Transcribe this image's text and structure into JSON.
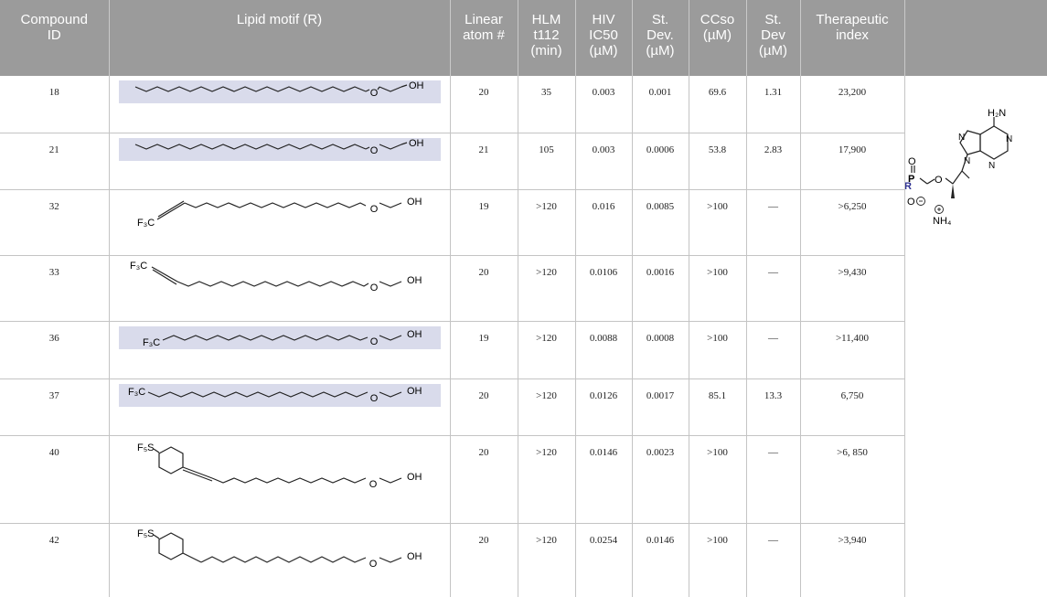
{
  "table": {
    "headers": {
      "compound": [
        "Compound",
        "ID"
      ],
      "motif": [
        "Lipid motif (R)"
      ],
      "linear": [
        "Linear",
        "atom #"
      ],
      "hlm": [
        "HLM",
        "t112",
        "(min)"
      ],
      "hiv": [
        "HIV",
        "IC50",
        "(µM)"
      ],
      "sd1": [
        "St.",
        "Dev.",
        "(µM)"
      ],
      "cc": [
        "CCso",
        "(µM)"
      ],
      "sd2": [
        "St.",
        "Dev",
        "(µM)"
      ],
      "ti": [
        "Therapeutic",
        "index"
      ]
    },
    "rows": [
      {
        "id": "18",
        "linear": "20",
        "hlm": "35",
        "hiv": "0.003",
        "sd1": "0.001",
        "cc": "69.6",
        "sd2": "1.31",
        "ti": "23,200"
      },
      {
        "id": "21",
        "linear": "21",
        "hlm": "105",
        "hiv": "0.003",
        "sd1": "0.0006",
        "cc": "53.8",
        "sd2": "2.83",
        "ti": "17,900"
      },
      {
        "id": "32",
        "linear": "19",
        "hlm": ">120",
        "hiv": "0.016",
        "sd1": "0.0085",
        "cc": ">100",
        "sd2": "—",
        "ti": ">6,250"
      },
      {
        "id": "33",
        "linear": "20",
        "hlm": ">120",
        "hiv": "0.0106",
        "sd1": "0.0016",
        "cc": ">100",
        "sd2": "—",
        "ti": ">9,430"
      },
      {
        "id": "36",
        "linear": "19",
        "hlm": ">120",
        "hiv": "0.0088",
        "sd1": "0.0008",
        "cc": ">100",
        "sd2": "—",
        "ti": ">11,400"
      },
      {
        "id": "37",
        "linear": "20",
        "hlm": ">120",
        "hiv": "0.0126",
        "sd1": "0.0017",
        "cc": "85.1",
        "sd2": "13.3",
        "ti": "6,750"
      },
      {
        "id": "40",
        "linear": "20",
        "hlm": ">120",
        "hiv": "0.0146",
        "sd1": "0.0023",
        "cc": ">100",
        "sd2": "—",
        "ti": ">6, 850"
      },
      {
        "id": "42",
        "linear": "20",
        "hlm": ">120",
        "hiv": "0.0254",
        "sd1": "0.0146",
        "cc": ">100",
        "sd2": "—",
        "ti": ">3,940"
      }
    ],
    "labels": {
      "oh": "OH",
      "o": "O",
      "f3c": "F₃C",
      "f5s": "F₅S",
      "r": "R",
      "h2n": "H₂N",
      "nh4": "NH₄",
      "n": "N",
      "p": "P"
    },
    "colors": {
      "header_bg": "#9b9b9b",
      "highlight": "#d9dbeb",
      "r_group": "#2e3192"
    }
  }
}
